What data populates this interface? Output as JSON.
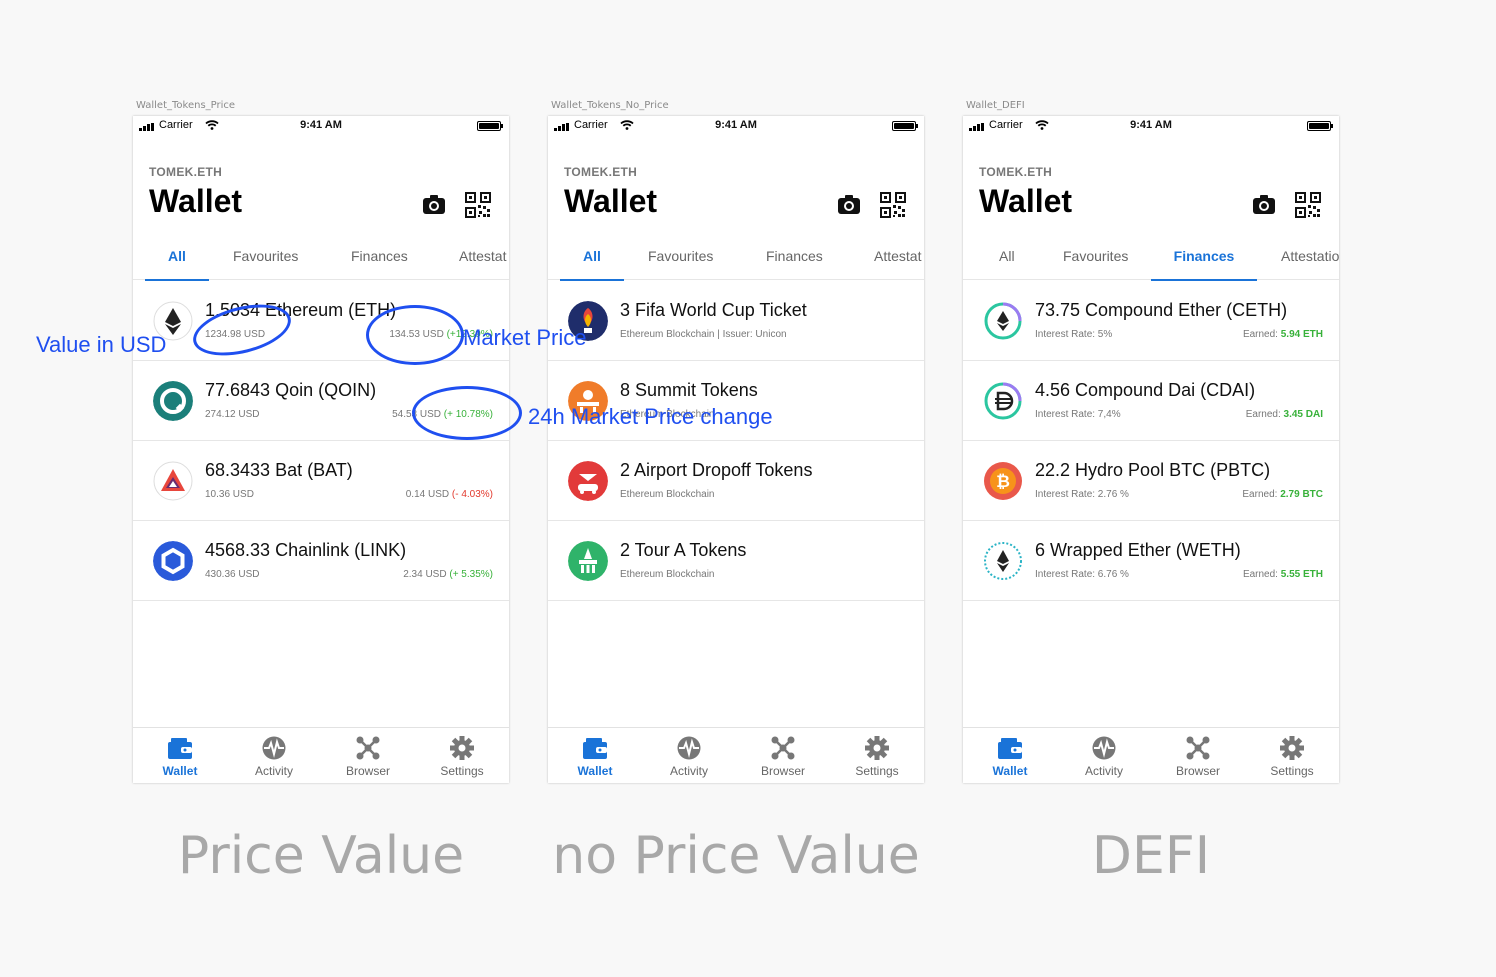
{
  "screens": [
    {
      "frame_label": "Wallet_Tokens_Price",
      "account": "TOMEK.ETH",
      "title": "Wallet",
      "tabs": [
        "All",
        "Favourites",
        "Finances",
        "Attestat"
      ],
      "active_tab": 0,
      "rows": [
        {
          "name": "1.5034 Ethereum (ETH)",
          "sub": "1234.98 USD",
          "right_prefix": "134.53 USD ",
          "right_value": "(+12.39%)",
          "right_color": "green",
          "icon": "ethereum-icon"
        },
        {
          "name": "77.6843 Qoin (QOIN)",
          "sub": "274.12 USD",
          "right_prefix": "54.53 USD ",
          "right_value": "(+ 10.78%)",
          "right_color": "green",
          "icon": "qoin-icon"
        },
        {
          "name": "68.3433 Bat (BAT)",
          "sub": "10.36 USD",
          "right_prefix": "0.14 USD ",
          "right_value": "(- 4.03%)",
          "right_color": "red",
          "icon": "bat-icon"
        },
        {
          "name": "4568.33 Chainlink (LINK)",
          "sub": "430.36 USD",
          "right_prefix": "2.34 USD ",
          "right_value": "(+ 5.35%)",
          "right_color": "green",
          "icon": "chainlink-icon"
        }
      ]
    },
    {
      "frame_label": "Wallet_Tokens_No_Price",
      "account": "TOMEK.ETH",
      "title": "Wallet",
      "tabs": [
        "All",
        "Favourites",
        "Finances",
        "Attestat"
      ],
      "active_tab": 0,
      "rows": [
        {
          "name": "3 Fifa World Cup Ticket",
          "sub": "Ethereum Blockchain  |  Issuer: Unicon",
          "icon": "fifa-icon"
        },
        {
          "name": "8 Summit Tokens",
          "sub": "Ethereum Blockchain",
          "icon": "summit-icon"
        },
        {
          "name": "2 Airport Dropoff Tokens",
          "sub": "Ethereum Blockchain",
          "icon": "airport-icon"
        },
        {
          "name": "2 Tour A Tokens",
          "sub": "Ethereum Blockchain",
          "icon": "tour-icon"
        }
      ]
    },
    {
      "frame_label": "Wallet_DEFI",
      "account": "TOMEK.ETH",
      "title": "Wallet",
      "tabs": [
        "All",
        "Favourites",
        "Finances",
        "Attestatio"
      ],
      "active_tab": 2,
      "rows": [
        {
          "name": "73.75 Compound Ether (CETH)",
          "sub": "Interest Rate: 5%",
          "right_prefix": "Earned: ",
          "right_value": "5.94 ETH",
          "right_color": "green",
          "icon": "compound-ether-icon"
        },
        {
          "name": "4.56 Compound Dai (CDAI)",
          "sub": "Interest Rate: 7,4%",
          "right_prefix": "Earned: ",
          "right_value": "3.45 DAI",
          "right_color": "green",
          "icon": "compound-dai-icon"
        },
        {
          "name": "22.2 Hydro Pool BTC (PBTC)",
          "sub": "Interest Rate: 2.76 %",
          "right_prefix": "Earned: ",
          "right_value": "2.79 BTC",
          "right_color": "green",
          "icon": "bitcoin-icon"
        },
        {
          "name": "6 Wrapped Ether (WETH)",
          "sub": "Interest Rate: 6.76 %",
          "right_prefix": "Earned: ",
          "right_value": "5.55 ETH",
          "right_color": "green",
          "icon": "wrapped-ether-icon"
        }
      ]
    }
  ],
  "status_bar": {
    "carrier": "Carrier",
    "time": "9:41 AM"
  },
  "tabbar": [
    "Wallet",
    "Activity",
    "Browser",
    "Settings"
  ],
  "captions": [
    "Price Value",
    "no Price Value",
    "DEFI"
  ],
  "annotations": {
    "value_usd": "Value in USD",
    "market_price": "Market Price",
    "change_24h": "24h Market Price change"
  },
  "colors": {
    "accent": "#1a73d8",
    "annotation": "#1f4ff0",
    "positive": "#38b13a",
    "negative": "#e23a2e"
  }
}
